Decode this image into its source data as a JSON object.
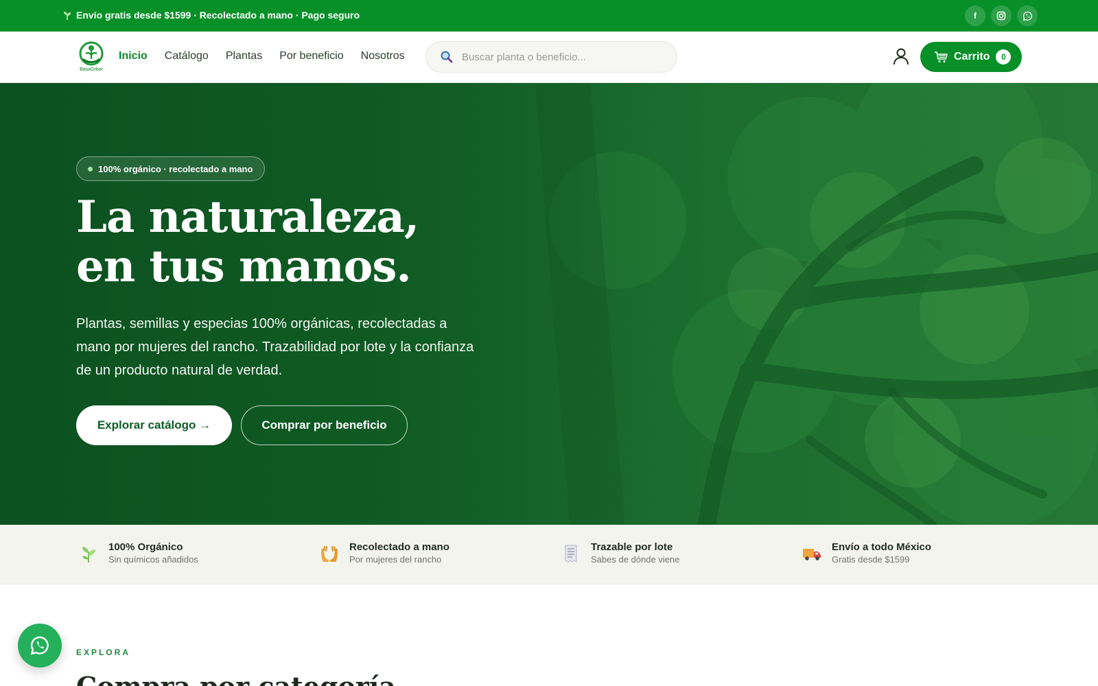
{
  "topbar": {
    "message": "Envío gratis desde $1599 · Recolectado a mano · Pago seguro",
    "socials": [
      {
        "icon": "facebook-icon",
        "label": "f"
      },
      {
        "icon": "instagram-icon",
        "label": ""
      },
      {
        "icon": "whatsapp-icon",
        "label": ""
      }
    ]
  },
  "nav": {
    "logo_text": "BasaGrbor",
    "links": [
      {
        "label": "Inicio",
        "active": true
      },
      {
        "label": "Catálogo",
        "active": false
      },
      {
        "label": "Plantas",
        "active": false
      },
      {
        "label": "Por beneficio",
        "active": false
      },
      {
        "label": "Nosotros",
        "active": false
      }
    ],
    "search_placeholder": "Buscar planta o beneficio...",
    "cart_label": "Carrito",
    "cart_count": "0"
  },
  "hero": {
    "badge": "100% orgánico · recolectado a mano",
    "title_line1": "La naturaleza,",
    "title_line2": "en tus manos.",
    "description": "Plantas, semillas y especias 100% orgánicas, recolectadas a mano por mujeres del rancho. Trazabilidad por lote y la confianza de un producto natural de verdad.",
    "primary_cta": "Explorar catálogo →",
    "secondary_cta": "Comprar por beneficio"
  },
  "features": [
    {
      "icon": "plant-icon",
      "title": "100% Orgánico",
      "subtitle": "Sin químicos añadidos"
    },
    {
      "icon": "hands-icon",
      "title": "Recolectado a mano",
      "subtitle": "Por mujeres del rancho"
    },
    {
      "icon": "receipt-icon",
      "title": "Trazable por lote",
      "subtitle": "Sabes de dónde viene"
    },
    {
      "icon": "truck-icon",
      "title": "Envío a todo México",
      "subtitle": "Gratis desde $1599"
    }
  ],
  "explore": {
    "label": "EXPLORA",
    "title": "Compra por categoría"
  },
  "colors": {
    "brand_green": "#079028",
    "hero_green": "#0f5a24",
    "accent_light": "#9fe3a8",
    "whatsapp": "#25b05c"
  }
}
